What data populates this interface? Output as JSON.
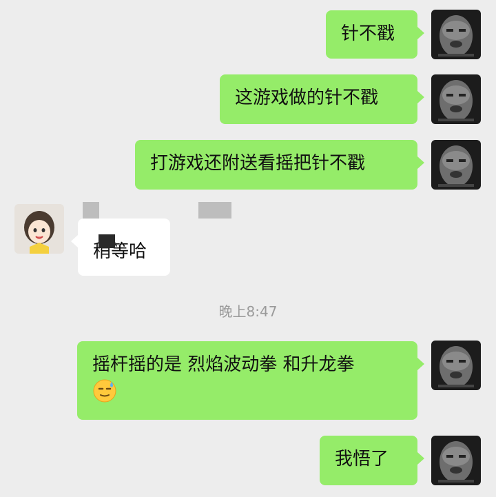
{
  "messages": [
    {
      "sender": "me",
      "text": "针不戳"
    },
    {
      "sender": "me",
      "text": "这游戏做的针不戳"
    },
    {
      "sender": "me",
      "text": "打游戏还附送看摇把针不戳"
    },
    {
      "sender": "other",
      "text": "稍等哈",
      "redacted_name": true
    },
    {
      "sender": "me",
      "text": "摇杆摇的是 烈焰波动拳 和升龙拳",
      "emoji": "sweat-smile-emoji"
    },
    {
      "sender": "me",
      "text": "我悟了"
    }
  ],
  "timestamp": "晚上8:47",
  "colors": {
    "background": "#ededed",
    "my_bubble": "#95ec69",
    "other_bubble": "#ffffff",
    "timestamp_text": "#9a9a9a"
  }
}
